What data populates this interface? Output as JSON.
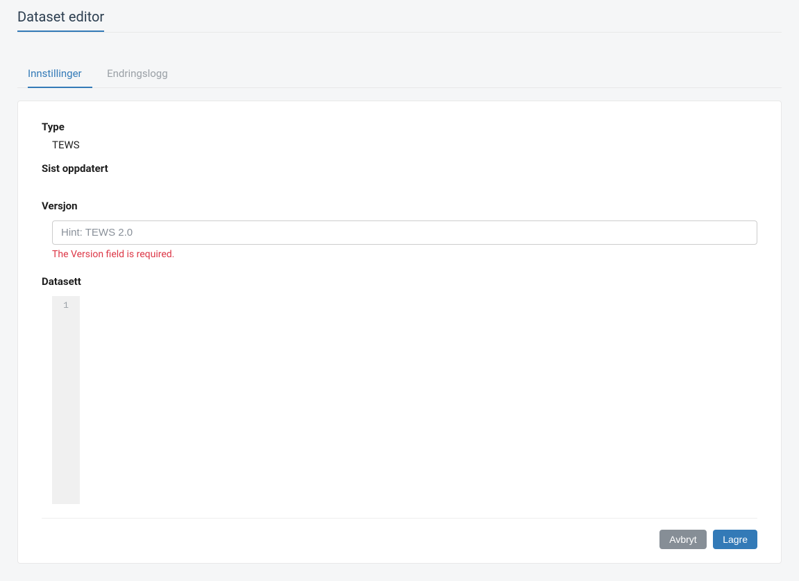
{
  "header": {
    "title": "Dataset editor"
  },
  "tabs": {
    "settings": "Innstillinger",
    "changelog": "Endringslogg"
  },
  "form": {
    "type_label": "Type",
    "type_value": "TEWS",
    "updated_label": "Sist oppdatert",
    "updated_value": "",
    "version_label": "Versjon",
    "version_placeholder": "Hint: TEWS 2.0",
    "version_value": "",
    "version_error": "The Version field is required.",
    "dataset_label": "Datasett",
    "editor_lines": [
      "1"
    ],
    "editor_content": ""
  },
  "buttons": {
    "cancel": "Avbryt",
    "save": "Lagre"
  }
}
